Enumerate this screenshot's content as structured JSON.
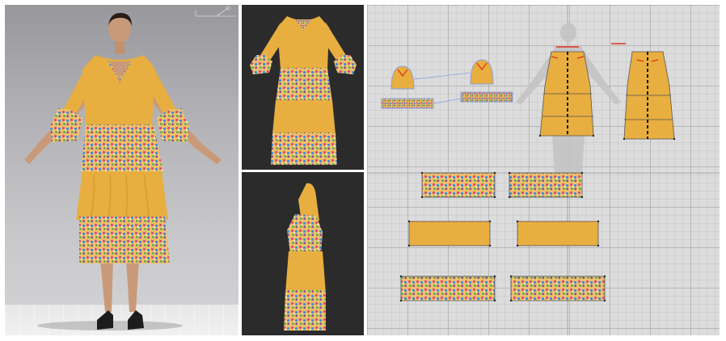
{
  "colors": {
    "fabric_solid": "#e8ae3f",
    "fabric_solid_dark": "#c98f29",
    "print_base": "#f2c16b",
    "print_accent_1": "#d64b7a",
    "print_accent_2": "#3a8fd1",
    "print_accent_3": "#6fb34b",
    "print_accent_4": "#7b4a9e",
    "viewport_3d_bg": "#b4b4b8",
    "viewport_dark_bg": "#2b2b2b",
    "pattern_grid_bg": "#dcdcdc",
    "seam_line": "#8aa0e0",
    "dart_mark": "#e0301e",
    "skin": "#c99a7a"
  },
  "icons": {
    "axis_gizmo": "axis-gizmo-icon"
  },
  "views": {
    "main_3d": "avatar-3d-viewport",
    "front_preview": "front-preview-viewport",
    "side_preview": "side-preview-viewport",
    "pattern_2d": "pattern-2d-window"
  }
}
